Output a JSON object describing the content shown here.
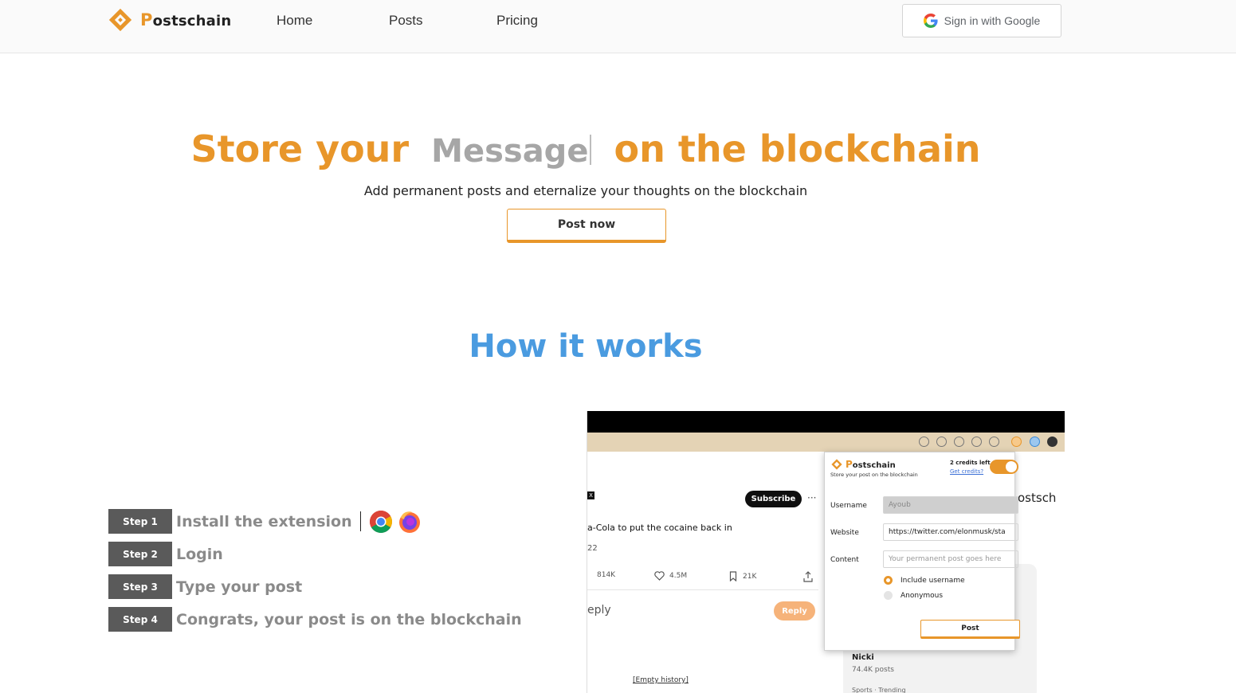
{
  "header": {
    "logo_initial": "P",
    "logo_rest": "ostschain",
    "nav": [
      "Home",
      "Posts",
      "Pricing"
    ],
    "signin_label": "Sign in with Google"
  },
  "hero": {
    "title_start": "Store your",
    "typed_word": "Message",
    "title_end": "on the blockchain",
    "subtitle": "Add permanent posts and eternalize your thoughts on the blockchain",
    "cta_label": "Post now"
  },
  "how": {
    "title": "How it works",
    "steps": [
      {
        "badge": "Step 1",
        "text": "Install the extension"
      },
      {
        "badge": "Step 2",
        "text": "Login"
      },
      {
        "badge": "Step 3",
        "text": "Type your post"
      },
      {
        "badge": "Step 4",
        "text_plain": "Congrats, your post is on the blockchain"
      }
    ]
  },
  "preview": {
    "subscribe": "Subscribe",
    "more": "···",
    "x_glyph": "X",
    "tweet_text": "a-Cola to put the cocaine back in",
    "tweet_date": "22",
    "metrics": [
      "814K",
      "4.5M",
      "21K"
    ],
    "reply_placeholder": "eply",
    "reply_button": "Reply",
    "empty_history": "[Empty history]",
    "trend_name": "Nicki",
    "trend_posts": "74.4K posts",
    "trend_category": "Sports · Trending",
    "side_text": "ostsch",
    "popup": {
      "name_initial": "P",
      "name_rest": "ostschain",
      "tagline": "Store your post on the blockchain",
      "credits": "2 credits left",
      "get_credits": "Get credits?",
      "username_label": "Username",
      "username_value": "Ayoub",
      "website_label": "Website",
      "website_value": "https://twitter.com/elonmusk/sta",
      "content_label": "Content",
      "content_placeholder": "Your permanent post goes here",
      "radio_include": "Include username",
      "radio_anon": "Anonymous",
      "post_button": "Post"
    }
  },
  "colors": {
    "brand_orange": "#e8962a",
    "how_blue": "#4a9be0",
    "step_badge": "#5a5a5a"
  }
}
